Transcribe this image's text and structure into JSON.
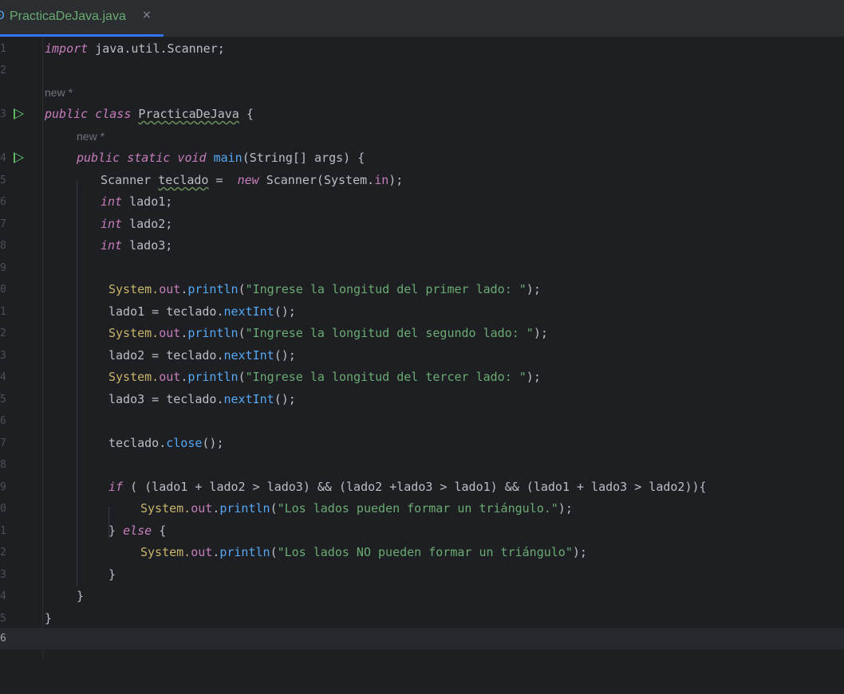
{
  "tab": {
    "title": "PracticaDeJava.java",
    "close": "×",
    "icon": "java-class-icon"
  },
  "hints": {
    "class_usage": "new *",
    "method_usage": "new *"
  },
  "line_numbers": [
    "1",
    "2",
    "3",
    "4",
    "5",
    "6",
    "7",
    "8",
    "9",
    "0",
    "1",
    "2",
    "3",
    "4",
    "5",
    "6",
    "7",
    "8",
    "9",
    "0",
    "1",
    "2",
    "3",
    "4",
    "5",
    "6"
  ],
  "code": {
    "l1_import": "import",
    "l1_rest": " java.util.Scanner;",
    "l3_public": "public",
    "l3_class": " class ",
    "l3_name": "PracticaDeJava",
    "l3_brace": " {",
    "l4_public": "public",
    "l4_static": " static",
    "l4_void": " void",
    "l4_main": " main",
    "l4_rest": "(String[] args) {",
    "l5_type": "Scanner ",
    "l5_var": "teclado",
    "l5_eq": " =  ",
    "l5_new": "new",
    "l5_ctor": " Scanner(System.",
    "l5_in": "in",
    "l5_end": ");",
    "int_kw": "int",
    "l6_var": " lado1;",
    "l7_var": " lado2;",
    "l8_var": " lado3;",
    "sys": "System.",
    "out": "out",
    "dot": ".",
    "println": "println",
    "open": "(",
    "str1": "\"Ingrese la longitud del primer lado: \"",
    "str2": "\"Ingrese la longitud del segundo lado: \"",
    "str3": "\"Ingrese la longitud del tercer lado: \"",
    "close": ");",
    "lado1_assign": "lado1 = teclado.",
    "lado2_assign": "lado2 = teclado.",
    "lado3_assign": "lado3 = teclado.",
    "nextInt": "nextInt",
    "call_end": "();",
    "teclado": "teclado.",
    "close_method": "close",
    "if_kw": "if",
    "if_cond": " ( (lado1 + lado2 > lado3) && (lado2 +lado3 > lado1) && (lado1 + lado3 > lado2)){",
    "str_yes": "\"Los lados pueden formar un triángulo.\"",
    "else_open": "} ",
    "else_kw": "else",
    "else_brace": " {",
    "str_no": "\"Los lados NO pueden formar un triángulo\"",
    "rbrace": "}"
  },
  "colors": {
    "background": "#1e1f22",
    "keyword": "#cf8e6d",
    "string": "#6aab73",
    "method": "#56a8f5",
    "field": "#c77dbb",
    "tab_underline": "#3574f0",
    "run_icon": "#5fb865"
  }
}
